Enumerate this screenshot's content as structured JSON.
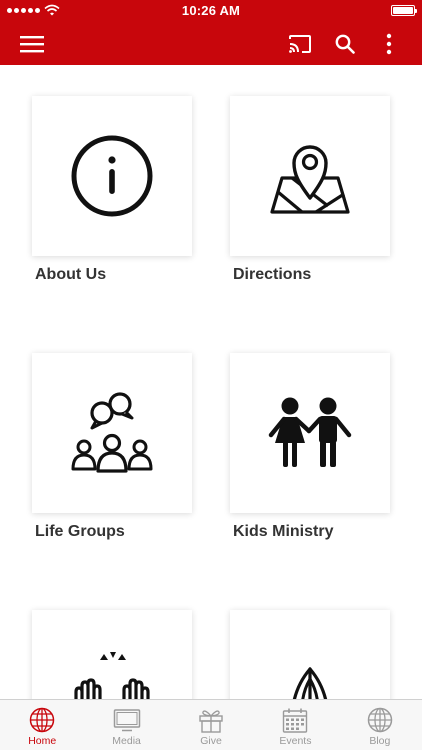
{
  "status_bar": {
    "time": "10:26 AM"
  },
  "toolbar": {
    "menu_icon": "hamburger-menu-icon",
    "cast_icon": "cast-icon",
    "search_icon": "search-icon",
    "more_icon": "more-vertical-icon"
  },
  "tiles": [
    {
      "label": "About Us",
      "icon": "info-icon"
    },
    {
      "label": "Directions",
      "icon": "map-pin-icon"
    },
    {
      "label": "Life Groups",
      "icon": "group-chat-icon"
    },
    {
      "label": "Kids Ministry",
      "icon": "children-icon"
    },
    {
      "label": "",
      "icon": "worship-hands-icon"
    },
    {
      "label": "",
      "icon": "praying-hands-icon"
    }
  ],
  "tabbar": {
    "tabs": [
      {
        "label": "Home",
        "icon": "globe-icon",
        "active": true
      },
      {
        "label": "Media",
        "icon": "tv-icon",
        "active": false
      },
      {
        "label": "Give",
        "icon": "gift-icon",
        "active": false
      },
      {
        "label": "Events",
        "icon": "calendar-icon",
        "active": false
      },
      {
        "label": "Blog",
        "icon": "globe-icon",
        "active": false
      }
    ]
  },
  "colors": {
    "accent": "#c8060c",
    "inactive_tab": "#9a9a9a"
  }
}
